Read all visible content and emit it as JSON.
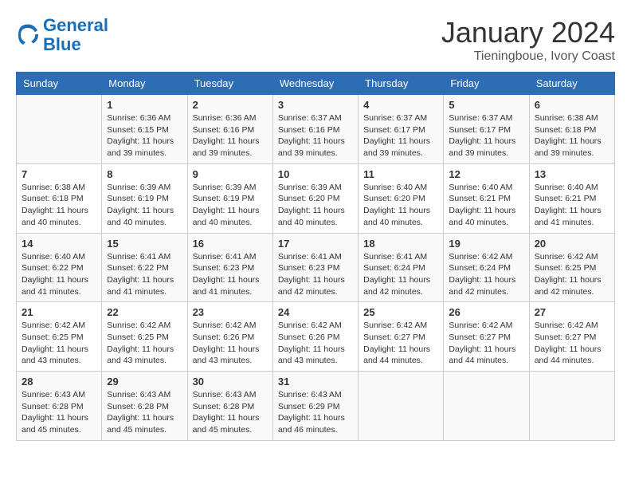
{
  "logo": {
    "text_general": "General",
    "text_blue": "Blue"
  },
  "header": {
    "month": "January 2024",
    "location": "Tieningboue, Ivory Coast"
  },
  "columns": [
    "Sunday",
    "Monday",
    "Tuesday",
    "Wednesday",
    "Thursday",
    "Friday",
    "Saturday"
  ],
  "weeks": [
    [
      {
        "day": "",
        "sunrise": "",
        "sunset": "",
        "daylight": ""
      },
      {
        "day": "1",
        "sunrise": "6:36 AM",
        "sunset": "6:15 PM",
        "daylight": "11 hours and 39 minutes."
      },
      {
        "day": "2",
        "sunrise": "6:36 AM",
        "sunset": "6:16 PM",
        "daylight": "11 hours and 39 minutes."
      },
      {
        "day": "3",
        "sunrise": "6:37 AM",
        "sunset": "6:16 PM",
        "daylight": "11 hours and 39 minutes."
      },
      {
        "day": "4",
        "sunrise": "6:37 AM",
        "sunset": "6:17 PM",
        "daylight": "11 hours and 39 minutes."
      },
      {
        "day": "5",
        "sunrise": "6:37 AM",
        "sunset": "6:17 PM",
        "daylight": "11 hours and 39 minutes."
      },
      {
        "day": "6",
        "sunrise": "6:38 AM",
        "sunset": "6:18 PM",
        "daylight": "11 hours and 39 minutes."
      }
    ],
    [
      {
        "day": "7",
        "sunrise": "6:38 AM",
        "sunset": "6:18 PM",
        "daylight": "11 hours and 40 minutes."
      },
      {
        "day": "8",
        "sunrise": "6:39 AM",
        "sunset": "6:19 PM",
        "daylight": "11 hours and 40 minutes."
      },
      {
        "day": "9",
        "sunrise": "6:39 AM",
        "sunset": "6:19 PM",
        "daylight": "11 hours and 40 minutes."
      },
      {
        "day": "10",
        "sunrise": "6:39 AM",
        "sunset": "6:20 PM",
        "daylight": "11 hours and 40 minutes."
      },
      {
        "day": "11",
        "sunrise": "6:40 AM",
        "sunset": "6:20 PM",
        "daylight": "11 hours and 40 minutes."
      },
      {
        "day": "12",
        "sunrise": "6:40 AM",
        "sunset": "6:21 PM",
        "daylight": "11 hours and 40 minutes."
      },
      {
        "day": "13",
        "sunrise": "6:40 AM",
        "sunset": "6:21 PM",
        "daylight": "11 hours and 41 minutes."
      }
    ],
    [
      {
        "day": "14",
        "sunrise": "6:40 AM",
        "sunset": "6:22 PM",
        "daylight": "11 hours and 41 minutes."
      },
      {
        "day": "15",
        "sunrise": "6:41 AM",
        "sunset": "6:22 PM",
        "daylight": "11 hours and 41 minutes."
      },
      {
        "day": "16",
        "sunrise": "6:41 AM",
        "sunset": "6:23 PM",
        "daylight": "11 hours and 41 minutes."
      },
      {
        "day": "17",
        "sunrise": "6:41 AM",
        "sunset": "6:23 PM",
        "daylight": "11 hours and 42 minutes."
      },
      {
        "day": "18",
        "sunrise": "6:41 AM",
        "sunset": "6:24 PM",
        "daylight": "11 hours and 42 minutes."
      },
      {
        "day": "19",
        "sunrise": "6:42 AM",
        "sunset": "6:24 PM",
        "daylight": "11 hours and 42 minutes."
      },
      {
        "day": "20",
        "sunrise": "6:42 AM",
        "sunset": "6:25 PM",
        "daylight": "11 hours and 42 minutes."
      }
    ],
    [
      {
        "day": "21",
        "sunrise": "6:42 AM",
        "sunset": "6:25 PM",
        "daylight": "11 hours and 43 minutes."
      },
      {
        "day": "22",
        "sunrise": "6:42 AM",
        "sunset": "6:25 PM",
        "daylight": "11 hours and 43 minutes."
      },
      {
        "day": "23",
        "sunrise": "6:42 AM",
        "sunset": "6:26 PM",
        "daylight": "11 hours and 43 minutes."
      },
      {
        "day": "24",
        "sunrise": "6:42 AM",
        "sunset": "6:26 PM",
        "daylight": "11 hours and 43 minutes."
      },
      {
        "day": "25",
        "sunrise": "6:42 AM",
        "sunset": "6:27 PM",
        "daylight": "11 hours and 44 minutes."
      },
      {
        "day": "26",
        "sunrise": "6:42 AM",
        "sunset": "6:27 PM",
        "daylight": "11 hours and 44 minutes."
      },
      {
        "day": "27",
        "sunrise": "6:42 AM",
        "sunset": "6:27 PM",
        "daylight": "11 hours and 44 minutes."
      }
    ],
    [
      {
        "day": "28",
        "sunrise": "6:43 AM",
        "sunset": "6:28 PM",
        "daylight": "11 hours and 45 minutes."
      },
      {
        "day": "29",
        "sunrise": "6:43 AM",
        "sunset": "6:28 PM",
        "daylight": "11 hours and 45 minutes."
      },
      {
        "day": "30",
        "sunrise": "6:43 AM",
        "sunset": "6:28 PM",
        "daylight": "11 hours and 45 minutes."
      },
      {
        "day": "31",
        "sunrise": "6:43 AM",
        "sunset": "6:29 PM",
        "daylight": "11 hours and 46 minutes."
      },
      {
        "day": "",
        "sunrise": "",
        "sunset": "",
        "daylight": ""
      },
      {
        "day": "",
        "sunrise": "",
        "sunset": "",
        "daylight": ""
      },
      {
        "day": "",
        "sunrise": "",
        "sunset": "",
        "daylight": ""
      }
    ]
  ],
  "labels": {
    "sunrise": "Sunrise:",
    "sunset": "Sunset:",
    "daylight": "Daylight:"
  }
}
